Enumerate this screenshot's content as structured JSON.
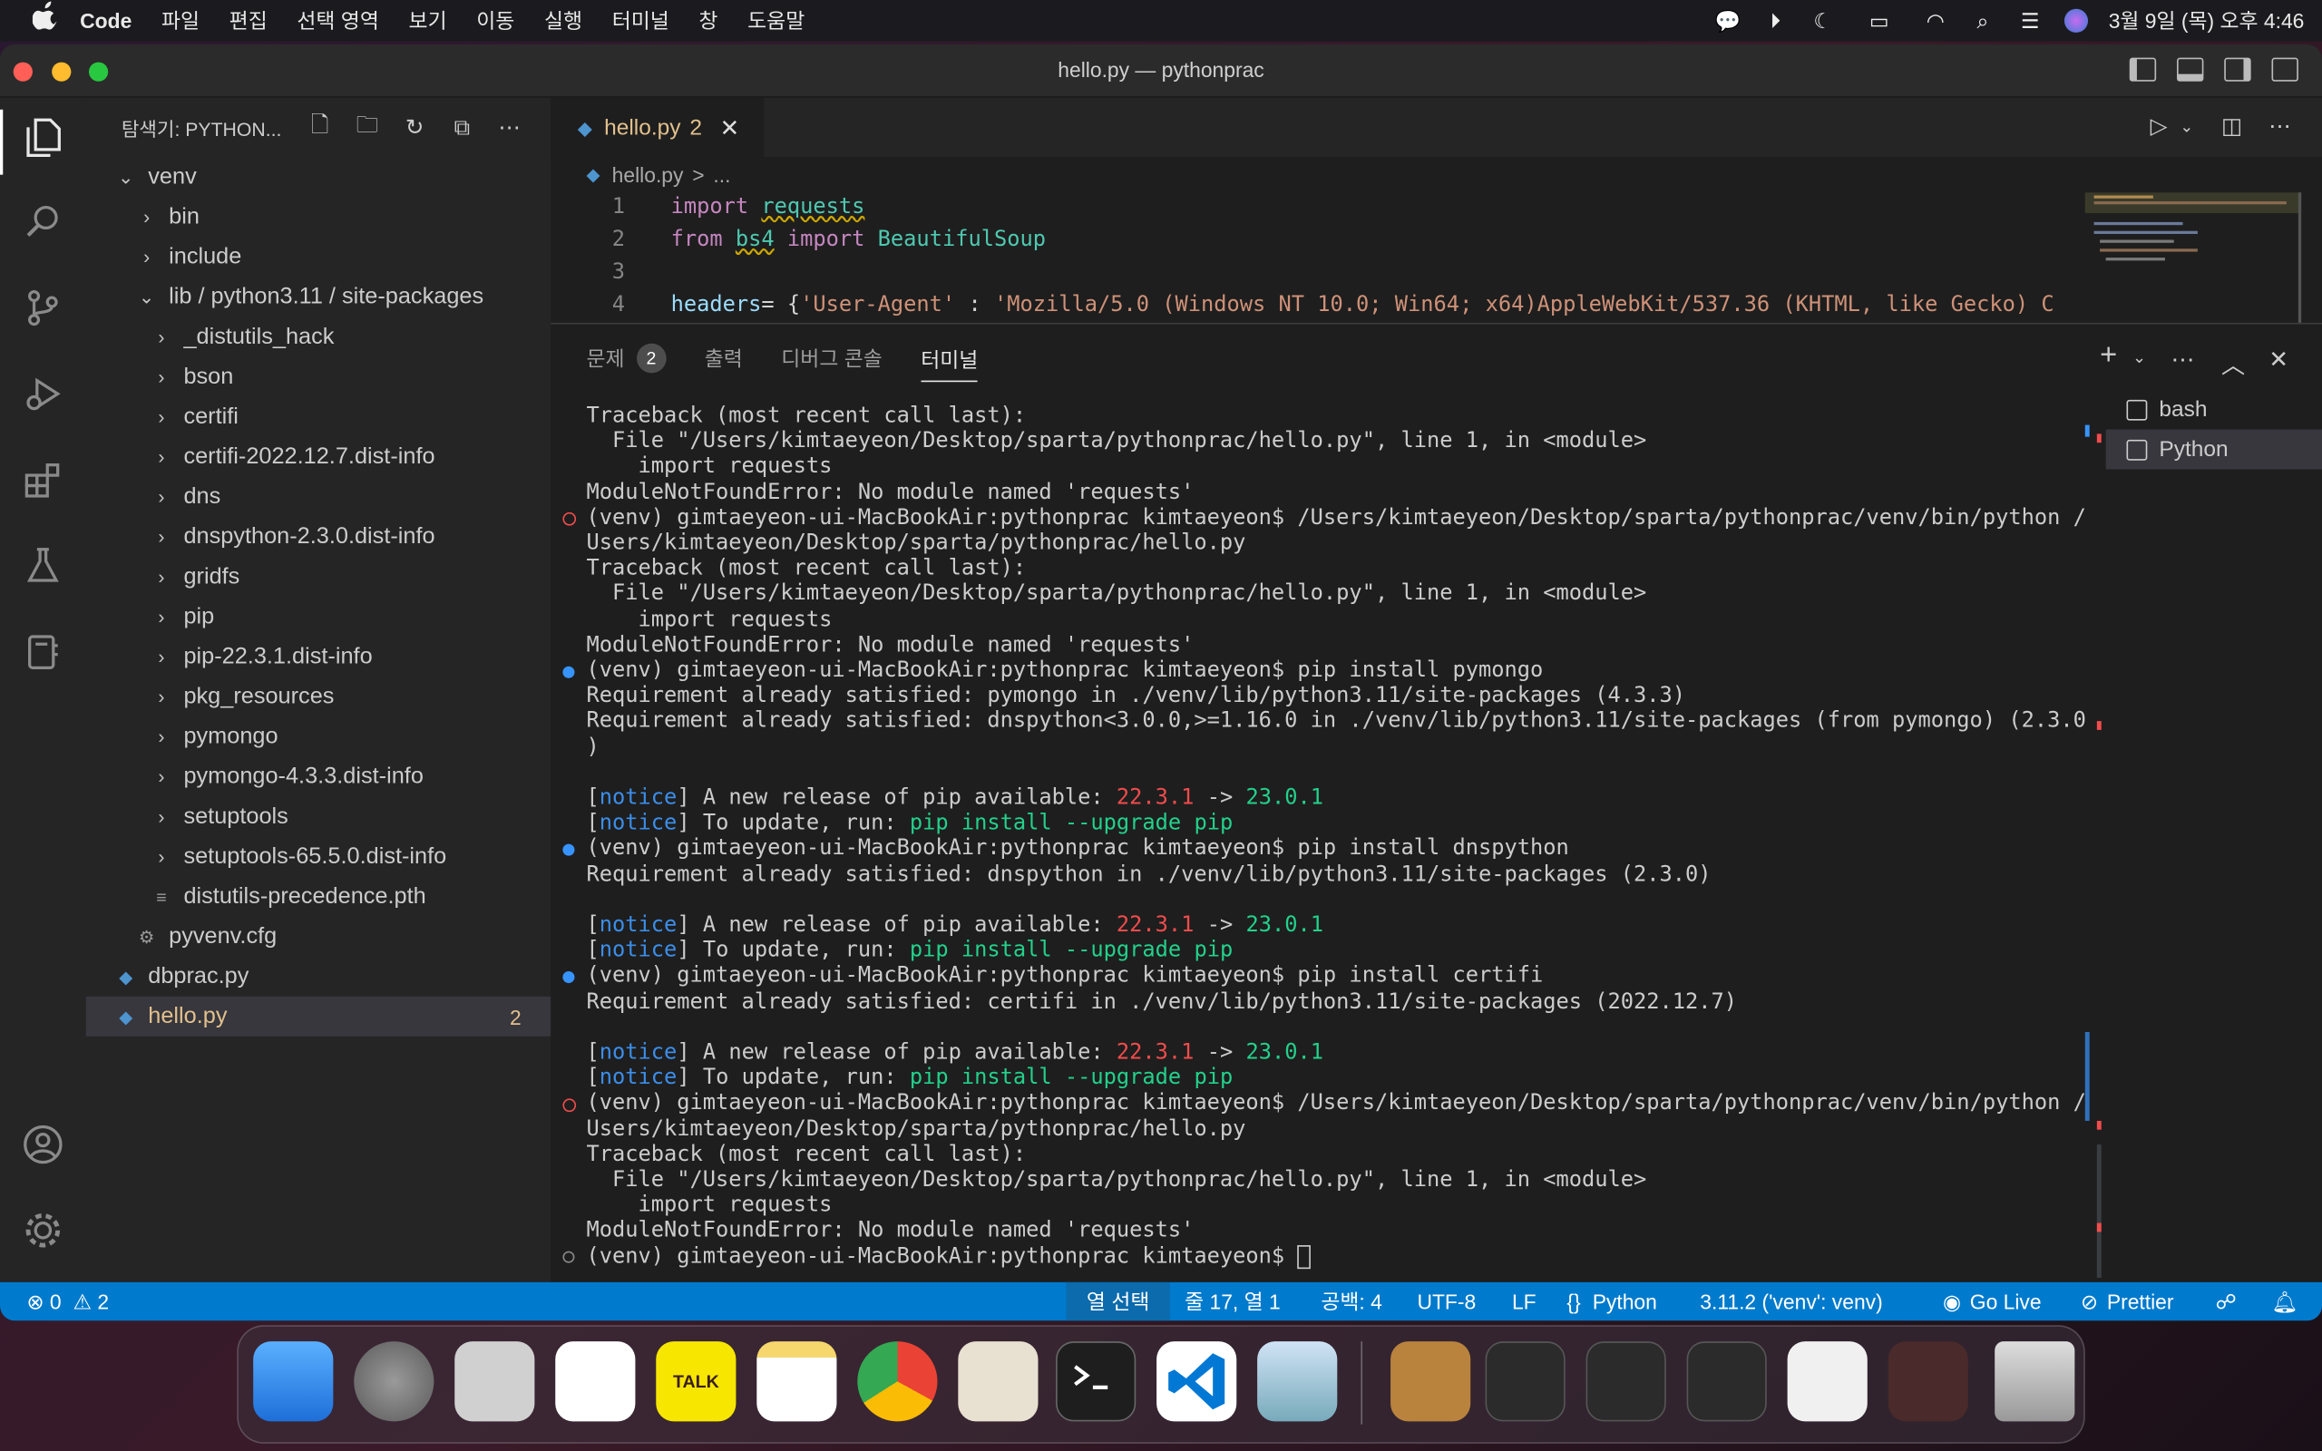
{
  "menubar": {
    "apple": "",
    "app": "Code",
    "items": [
      "파일",
      "편집",
      "선택 영역",
      "보기",
      "이동",
      "실행",
      "터미널",
      "창",
      "도움말"
    ],
    "clock": "3월 9일 (목) 오후 4:46"
  },
  "window": {
    "title": "hello.py — pythonprac"
  },
  "sidebar": {
    "header": "탐색기: PYTHON...",
    "tree": [
      {
        "label": "venv",
        "type": "folder-open",
        "indent": 0
      },
      {
        "label": "bin",
        "type": "folder",
        "indent": 1
      },
      {
        "label": "include",
        "type": "folder",
        "indent": 1
      },
      {
        "label": "lib / python3.11 / site-packages",
        "type": "folder-open",
        "indent": 1
      },
      {
        "label": "_distutils_hack",
        "type": "folder",
        "indent": 2
      },
      {
        "label": "bson",
        "type": "folder",
        "indent": 2
      },
      {
        "label": "certifi",
        "type": "folder",
        "indent": 2
      },
      {
        "label": "certifi-2022.12.7.dist-info",
        "type": "folder",
        "indent": 2
      },
      {
        "label": "dns",
        "type": "folder",
        "indent": 2
      },
      {
        "label": "dnspython-2.3.0.dist-info",
        "type": "folder",
        "indent": 2
      },
      {
        "label": "gridfs",
        "type": "folder",
        "indent": 2
      },
      {
        "label": "pip",
        "type": "folder",
        "indent": 2
      },
      {
        "label": "pip-22.3.1.dist-info",
        "type": "folder",
        "indent": 2
      },
      {
        "label": "pkg_resources",
        "type": "folder",
        "indent": 2
      },
      {
        "label": "pymongo",
        "type": "folder",
        "indent": 2
      },
      {
        "label": "pymongo-4.3.3.dist-info",
        "type": "folder",
        "indent": 2
      },
      {
        "label": "setuptools",
        "type": "folder",
        "indent": 2
      },
      {
        "label": "setuptools-65.5.0.dist-info",
        "type": "folder",
        "indent": 2
      },
      {
        "label": "distutils-precedence.pth",
        "type": "file-lines",
        "indent": 2
      },
      {
        "label": "pyvenv.cfg",
        "type": "file-gear",
        "indent": 1
      },
      {
        "label": "dbprac.py",
        "type": "file-python",
        "indent": 0
      },
      {
        "label": "hello.py",
        "type": "file-python",
        "indent": 0,
        "selected": true,
        "badge": "2"
      }
    ]
  },
  "editor": {
    "tab": {
      "label": "hello.py",
      "problems": "2"
    },
    "breadcrumb": [
      "hello.py",
      ">",
      "..."
    ],
    "lines": [
      {
        "n": "1",
        "parts": [
          [
            "kw",
            "import "
          ],
          [
            "mod sq",
            "requests"
          ]
        ]
      },
      {
        "n": "2",
        "parts": [
          [
            "kw",
            "from "
          ],
          [
            "mod sq",
            "bs4"
          ],
          [
            "kw",
            " import "
          ],
          [
            "mod",
            "BeautifulSoup"
          ]
        ]
      },
      {
        "n": "3",
        "parts": []
      },
      {
        "n": "4",
        "parts": [
          [
            "var",
            "headers"
          ],
          [
            "",
            "= {"
          ],
          [
            "str",
            "'User-Agent'"
          ],
          [
            "",
            " : "
          ],
          [
            "str",
            "'Mozilla/5.0 (Windows NT 10.0; Win64; x64)AppleWebKit/537.36 (KHTML, like Gecko) C"
          ]
        ]
      }
    ]
  },
  "panel": {
    "tabs": [
      {
        "label": "문제",
        "count": "2"
      },
      {
        "label": "출력"
      },
      {
        "label": "디버그 콘솔"
      },
      {
        "label": "터미널",
        "active": true
      }
    ],
    "terminals": [
      "bash",
      "Python"
    ],
    "terminal_lines": [
      {
        "dot": "",
        "parts": [
          [
            "",
            "Traceback (most recent call last):"
          ]
        ]
      },
      {
        "dot": "",
        "parts": [
          [
            "",
            "  File \"/Users/kimtaeyeon/Desktop/sparta/pythonprac/hello.py\", line 1, in <module>"
          ]
        ]
      },
      {
        "dot": "",
        "parts": [
          [
            "",
            "    import requests"
          ]
        ]
      },
      {
        "dot": "",
        "parts": [
          [
            "",
            "ModuleNotFoundError: No module named 'requests'"
          ]
        ]
      },
      {
        "dot": "r",
        "parts": [
          [
            "",
            "(venv) gimtaeyeon-ui-MacBookAir:pythonprac kimtaeyeon$ /Users/kimtaeyeon/Desktop/sparta/pythonprac/venv/bin/python /"
          ]
        ]
      },
      {
        "dot": "",
        "parts": [
          [
            "",
            "Users/kimtaeyeon/Desktop/sparta/pythonprac/hello.py"
          ]
        ]
      },
      {
        "dot": "",
        "parts": [
          [
            "",
            "Traceback (most recent call last):"
          ]
        ]
      },
      {
        "dot": "",
        "parts": [
          [
            "",
            "  File \"/Users/kimtaeyeon/Desktop/sparta/pythonprac/hello.py\", line 1, in <module>"
          ]
        ]
      },
      {
        "dot": "",
        "parts": [
          [
            "",
            "    import requests"
          ]
        ]
      },
      {
        "dot": "",
        "parts": [
          [
            "",
            "ModuleNotFoundError: No module named 'requests'"
          ]
        ]
      },
      {
        "dot": "b",
        "parts": [
          [
            "",
            "(venv) gimtaeyeon-ui-MacBookAir:pythonprac kimtaeyeon$ pip install pymongo"
          ]
        ]
      },
      {
        "dot": "",
        "parts": [
          [
            "",
            "Requirement already satisfied: pymongo in ./venv/lib/python3.11/site-packages (4.3.3)"
          ]
        ]
      },
      {
        "dot": "",
        "parts": [
          [
            "",
            "Requirement already satisfied: dnspython<3.0.0,>=1.16.0 in ./venv/lib/python3.11/site-packages (from pymongo) (2.3.0"
          ]
        ]
      },
      {
        "dot": "",
        "parts": [
          [
            "",
            ")"
          ]
        ]
      },
      {
        "dot": "",
        "parts": []
      },
      {
        "dot": "",
        "parts": [
          [
            "",
            "["
          ],
          [
            "nb",
            "notice"
          ],
          [
            "",
            "] A new release of pip available: "
          ],
          [
            "rd",
            "22.3.1"
          ],
          [
            "",
            " -> "
          ],
          [
            "gr",
            "23.0.1"
          ]
        ]
      },
      {
        "dot": "",
        "parts": [
          [
            "",
            "["
          ],
          [
            "nb",
            "notice"
          ],
          [
            "",
            "] To update, run: "
          ],
          [
            "gr",
            "pip install --upgrade pip"
          ]
        ]
      },
      {
        "dot": "b",
        "parts": [
          [
            "",
            "(venv) gimtaeyeon-ui-MacBookAir:pythonprac kimtaeyeon$ pip install dnspython"
          ]
        ]
      },
      {
        "dot": "",
        "parts": [
          [
            "",
            "Requirement already satisfied: dnspython in ./venv/lib/python3.11/site-packages (2.3.0)"
          ]
        ]
      },
      {
        "dot": "",
        "parts": []
      },
      {
        "dot": "",
        "parts": [
          [
            "",
            "["
          ],
          [
            "nb",
            "notice"
          ],
          [
            "",
            "] A new release of pip available: "
          ],
          [
            "rd",
            "22.3.1"
          ],
          [
            "",
            " -> "
          ],
          [
            "gr",
            "23.0.1"
          ]
        ]
      },
      {
        "dot": "",
        "parts": [
          [
            "",
            "["
          ],
          [
            "nb",
            "notice"
          ],
          [
            "",
            "] To update, run: "
          ],
          [
            "gr",
            "pip install --upgrade pip"
          ]
        ]
      },
      {
        "dot": "b",
        "parts": [
          [
            "",
            "(venv) gimtaeyeon-ui-MacBookAir:pythonprac kimtaeyeon$ pip install certifi"
          ]
        ]
      },
      {
        "dot": "",
        "parts": [
          [
            "",
            "Requirement already satisfied: certifi in ./venv/lib/python3.11/site-packages (2022.12.7)"
          ]
        ]
      },
      {
        "dot": "",
        "parts": []
      },
      {
        "dot": "",
        "parts": [
          [
            "",
            "["
          ],
          [
            "nb",
            "notice"
          ],
          [
            "",
            "] A new release of pip available: "
          ],
          [
            "rd",
            "22.3.1"
          ],
          [
            "",
            " -> "
          ],
          [
            "gr",
            "23.0.1"
          ]
        ]
      },
      {
        "dot": "",
        "parts": [
          [
            "",
            "["
          ],
          [
            "nb",
            "notice"
          ],
          [
            "",
            "] To update, run: "
          ],
          [
            "gr",
            "pip install --upgrade pip"
          ]
        ]
      },
      {
        "dot": "r",
        "parts": [
          [
            "",
            "(venv) gimtaeyeon-ui-MacBookAir:pythonprac kimtaeyeon$ /Users/kimtaeyeon/Desktop/sparta/pythonprac/venv/bin/python /"
          ]
        ]
      },
      {
        "dot": "",
        "parts": [
          [
            "",
            "Users/kimtaeyeon/Desktop/sparta/pythonprac/hello.py"
          ]
        ]
      },
      {
        "dot": "",
        "parts": [
          [
            "",
            "Traceback (most recent call last):"
          ]
        ]
      },
      {
        "dot": "",
        "parts": [
          [
            "",
            "  File \"/Users/kimtaeyeon/Desktop/sparta/pythonprac/hello.py\", line 1, in <module>"
          ]
        ]
      },
      {
        "dot": "",
        "parts": [
          [
            "",
            "    import requests"
          ]
        ]
      },
      {
        "dot": "",
        "parts": [
          [
            "",
            "ModuleNotFoundError: No module named 'requests'"
          ]
        ]
      },
      {
        "dot": "g",
        "parts": [
          [
            "",
            "(venv) gimtaeyeon-ui-MacBookAir:pythonprac kimtaeyeon$ "
          ]
        ],
        "cursor": true
      }
    ]
  },
  "statusbar": {
    "errors": "0",
    "warnings": "2",
    "selection_mode": "열 선택",
    "position": "줄 17, 열 1",
    "spaces": "공백: 4",
    "encoding": "UTF-8",
    "eol": "LF",
    "language": "Python",
    "interpreter": "3.11.2 ('venv': venv)",
    "golive": "Go Live",
    "prettier": "Prettier"
  },
  "colors": {
    "accent": "#007acc",
    "modified": "#e2c08d"
  },
  "dock": [
    "finder-icon",
    "settings-icon",
    "launchpad-icon",
    "slack-icon",
    "kakaotalk-icon",
    "notes-icon",
    "chrome-icon",
    "tableplus-icon",
    "terminal-icon",
    "vscode-icon",
    "preview-icon",
    "archive-icon",
    "window-thumb",
    "window-thumb",
    "window-thumb",
    "window-thumb",
    "window-thumb",
    "trash-icon"
  ],
  "dock_labels": {
    "kakaotalk": "TALK"
  }
}
